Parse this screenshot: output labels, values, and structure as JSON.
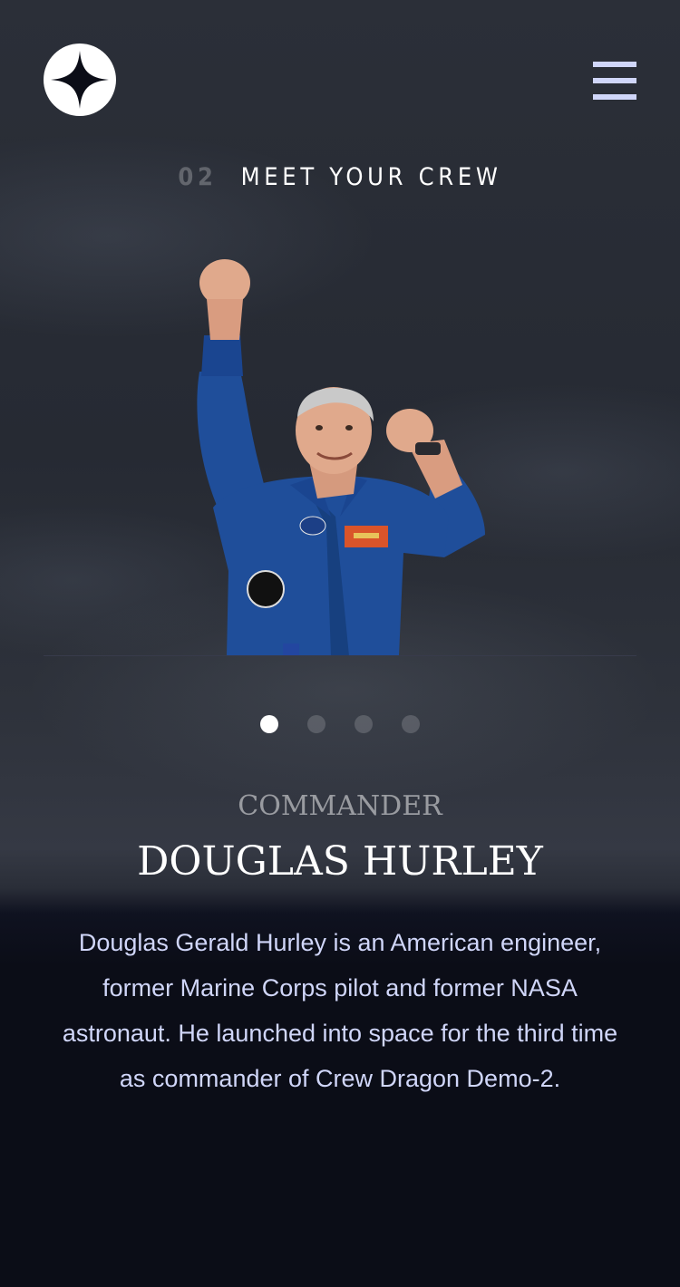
{
  "header": {
    "logo_icon": "star-logo-icon",
    "menu_icon": "hamburger-menu-icon"
  },
  "section": {
    "number": "02",
    "title": "MEET YOUR CREW"
  },
  "crew": {
    "image_alt": "Douglas Hurley",
    "role": "COMMANDER",
    "name": "DOUGLAS HURLEY",
    "bio": "Douglas Gerald Hurley is an American engineer, former Marine Corps pilot and former NASA astronaut. He launched into space for the third time as commander of Crew Dragon Demo-2."
  },
  "carousel": {
    "total": 4,
    "active_index": 0
  },
  "colors": {
    "accent": "#d0d6f9",
    "background": "#0b0d17",
    "suit": "#1f4e9a"
  }
}
